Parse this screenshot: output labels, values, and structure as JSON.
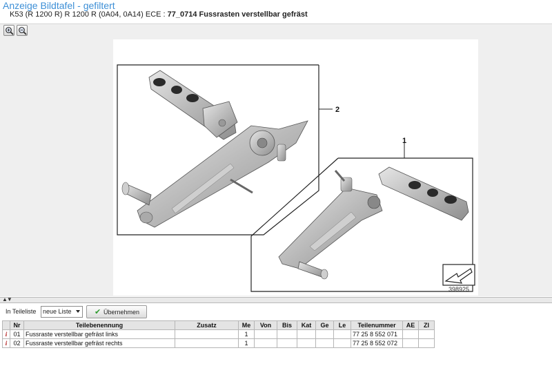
{
  "header": {
    "title": "Anzeige Bildtafel - gefiltert",
    "model": "K53 (R 1200 R) R 1200 R (0A04, 0A14) ECE : ",
    "diagram": "77_0714 Fussrasten verstellbar gefräst"
  },
  "zoom": {
    "in_icon": "zoom-in-icon",
    "out_icon": "zoom-out-icon"
  },
  "figure": {
    "callouts": [
      "2",
      "1"
    ],
    "number": "398925"
  },
  "splitter": {
    "arrows": "▲▼"
  },
  "toolbar": {
    "list_label": "In Teileliste",
    "list_value": "neue Liste",
    "apply_label": "Übernehmen"
  },
  "table": {
    "headers": [
      "",
      "Nr",
      "Teilebenennung",
      "Zusatz",
      "Me",
      "Von",
      "Bis",
      "Kat",
      "Ge",
      "Le",
      "Teilenummer",
      "AE",
      "ZI"
    ],
    "rows": [
      {
        "info": "i",
        "nr": "01",
        "name": "Fussraste verstellbar gefräst links",
        "zusatz": "",
        "me": "1",
        "von": "",
        "bis": "",
        "kat": "",
        "ge": "",
        "le": "",
        "teilenummer": "77 25 8 552 071",
        "ae": "",
        "zi": ""
      },
      {
        "info": "i",
        "nr": "02",
        "name": "Fussraste verstellbar gefräst rechts",
        "zusatz": "",
        "me": "1",
        "von": "",
        "bis": "",
        "kat": "",
        "ge": "",
        "le": "",
        "teilenummer": "77 25 8 552 072",
        "ae": "",
        "zi": ""
      }
    ]
  }
}
